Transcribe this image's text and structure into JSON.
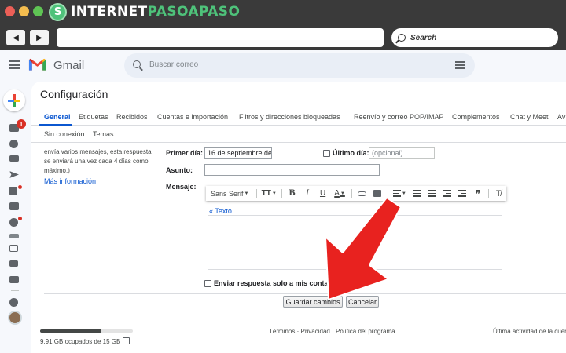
{
  "browser": {
    "brand_logo_letter": "S",
    "brand_part1": "INTERNET",
    "brand_part2": "PASOAPASO",
    "search_label": "Search",
    "colors": {
      "brand_green": "#4ec27a",
      "chrome": "#3a3a3a"
    }
  },
  "gmail": {
    "app_name": "Gmail",
    "search_placeholder": "Buscar correo",
    "unread_badge": "1",
    "page_title": "Configuración",
    "tabs": [
      {
        "label": "General",
        "active": true
      },
      {
        "label": "Etiquetas"
      },
      {
        "label": "Recibidos"
      },
      {
        "label": "Cuentas e importación"
      },
      {
        "label": "Filtros y direcciones bloqueadas"
      },
      {
        "label": "Reenvío y correo POP/IMAP"
      },
      {
        "label": "Complementos"
      },
      {
        "label": "Chat y Meet"
      },
      {
        "label": "Av"
      }
    ],
    "tabs2": [
      {
        "label": "Sin conexión"
      },
      {
        "label": "Temas"
      }
    ],
    "side_text": "envía varios mensajes, esta respuesta se enviará una vez cada 4 días como máximo.)",
    "side_link": "Más información",
    "form": {
      "first_day_label": "Primer día:",
      "first_day_value": "16 de septiembre de",
      "last_day_label": "Último día:",
      "last_day_placeholder": "(opcional)",
      "subject_label": "Asunto:",
      "subject_value": "",
      "message_label": "Mensaje:",
      "font_name": "Sans Serif",
      "text_link": "« Texto",
      "contacts_only_label": "Enviar respuesta solo a mis contactos",
      "save_button": "Guardar cambios",
      "cancel_button": "Cancelar"
    },
    "toolbar_icons": [
      "text-size-icon",
      "bold-icon",
      "italic-icon",
      "underline-icon",
      "text-color-icon",
      "link-icon",
      "image-icon",
      "align-icon",
      "numbered-list-icon",
      "bulleted-list-icon",
      "indent-less-icon",
      "indent-more-icon",
      "quote-icon",
      "remove-formatting-icon"
    ],
    "footer": {
      "storage_text": "9,91 GB ocupados de 15 GB",
      "storage_fraction": 0.66,
      "terms": "Términos",
      "privacy": "Privacidad",
      "policy": "Política del programa",
      "sep": "·",
      "last_activity": "Última actividad de la cuen"
    },
    "colors": {
      "accent": "#0b57d0",
      "annotation_arrow": "#e8221f"
    }
  }
}
